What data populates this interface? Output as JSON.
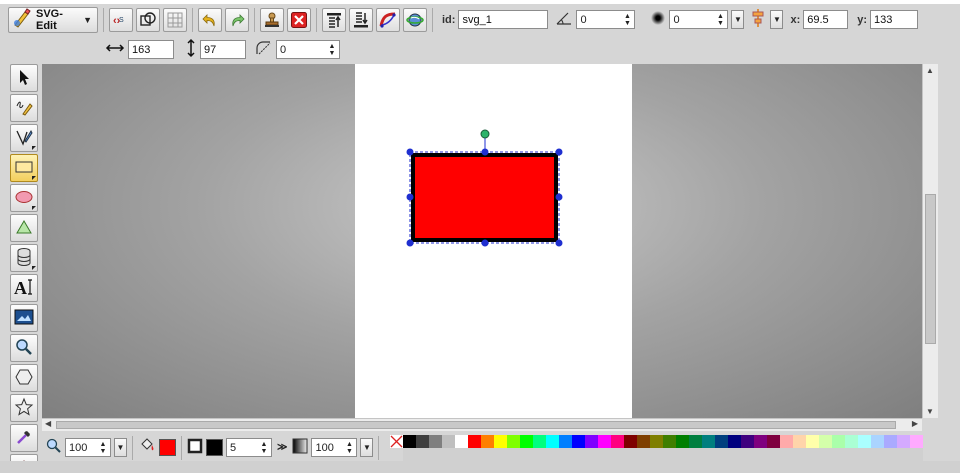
{
  "app": {
    "name": "SVG-Edit"
  },
  "toolbar": {
    "id_label": "id:",
    "id_value": "svg_1",
    "angle_value": "0",
    "blur_value": "0",
    "x_label": "x:",
    "x_value": "69.5",
    "y_label": "y:",
    "y_value": "133",
    "width_value": "163",
    "height_value": "97",
    "radius_value": "0"
  },
  "bottom": {
    "zoom_value": "100",
    "stroke_width_value": "5",
    "opacity_value": "100"
  },
  "colors": {
    "fill": "#ff0000",
    "stroke": "#000000",
    "selection_handle": "#1f2fd0",
    "rotate_handle": "#2db36b",
    "palette_row1": [
      "#000000",
      "#3f3f3f",
      "#7f7f7f",
      "#bfbfbf",
      "#ffffff",
      "#ff0000",
      "#ff7f00",
      "#ffff00",
      "#7fff00",
      "#00ff00",
      "#00ff7f",
      "#00ffff",
      "#007fff",
      "#0000ff",
      "#7f00ff",
      "#ff00ff",
      "#ff007f",
      "#7f0000",
      "#7f3f00",
      "#7f7f00",
      "#3f7f00",
      "#007f00",
      "#007f3f",
      "#007f7f",
      "#003f7f",
      "#00007f",
      "#3f007f",
      "#7f007f",
      "#7f003f",
      "#ffaaaa",
      "#ffd4aa",
      "#ffffaa",
      "#d4ffaa",
      "#aaffaa",
      "#aaffd4",
      "#aaffff",
      "#aad4ff",
      "#aaaaff",
      "#d4aaff",
      "#ffaaff"
    ],
    "palette_row2": [
      "#d0d0d0",
      "#d0d0d0",
      "#d0d0d0",
      "#d0d0d0",
      "#d0d0d0",
      "#d0d0d0",
      "#d0d0d0",
      "#d0d0d0",
      "#d0d0d0",
      "#d0d0d0",
      "#d0d0d0",
      "#d0d0d0",
      "#d0d0d0",
      "#d0d0d0",
      "#d0d0d0",
      "#d0d0d0",
      "#d0d0d0",
      "#d0d0d0",
      "#d0d0d0",
      "#d0d0d0",
      "#d0d0d0",
      "#d0d0d0",
      "#d0d0d0",
      "#d0d0d0",
      "#d0d0d0",
      "#d0d0d0",
      "#d0d0d0",
      "#d0d0d0",
      "#d0d0d0",
      "#d0d0d0",
      "#d0d0d0",
      "#d0d0d0",
      "#d0d0d0",
      "#d0d0d0",
      "#d0d0d0",
      "#d0d0d0",
      "#d0d0d0",
      "#d0d0d0",
      "#d0d0d0",
      "#d0d0d0"
    ]
  },
  "icons": {
    "left_tools": [
      "select-arrow-icon",
      "pencil-icon",
      "path-pen-icon",
      "rectangle-icon",
      "ellipse-icon",
      "polygon-path-icon",
      "library-stack-icon",
      "text-icon",
      "image-icon",
      "zoom-icon",
      "hexagon-icon",
      "star-icon",
      "eyedropper-icon",
      "shape-library-icon"
    ]
  }
}
